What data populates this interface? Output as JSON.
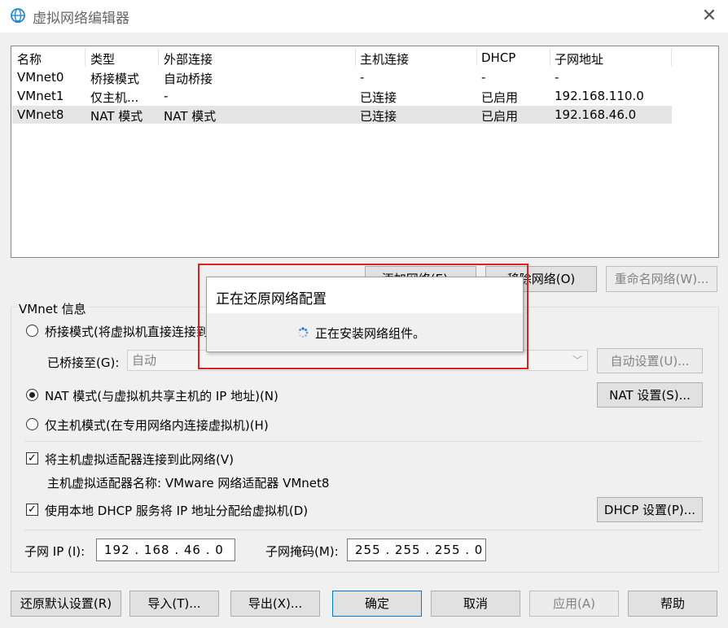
{
  "window": {
    "title": "虚拟网络编辑器",
    "close_icon": "close-icon"
  },
  "table": {
    "columns": [
      "名称",
      "类型",
      "外部连接",
      "主机连接",
      "DHCP",
      "子网地址"
    ],
    "rows": [
      [
        "VMnet0",
        "桥接模式",
        "自动桥接",
        "-",
        "-",
        "-"
      ],
      [
        "VMnet1",
        "仅主机...",
        "-",
        "已连接",
        "已启用",
        "192.168.110.0"
      ],
      [
        "VMnet8",
        "NAT 模式",
        "NAT 模式",
        "已连接",
        "已启用",
        "192.168.46.0"
      ]
    ],
    "selected_row": 2
  },
  "list_buttons": {
    "add": "添加网络(E)...",
    "remove": "移除网络(O)",
    "rename": "重命名网络(W)..."
  },
  "info": {
    "group_title": "VMnet 信息",
    "bridge_label": "桥接模式(将虚拟机直接连接到外部网络)(B)",
    "bridged_to_label": "已桥接至(G):",
    "bridged_to_value": "自动",
    "auto_settings": "自动设置(U)...",
    "nat_label": "NAT 模式(与虚拟机共享主机的 IP 地址)(N)",
    "nat_settings": "NAT 设置(S)...",
    "hostonly_label": "仅主机模式(在专用网络内连接虚拟机)(H)",
    "selected_mode": "nat",
    "connect_adapter_label": "将主机虚拟适配器连接到此网络(V)",
    "connect_adapter_checked": true,
    "adapter_name_label": "主机虚拟适配器名称: VMware 网络适配器 VMnet8",
    "dhcp_label": "使用本地 DHCP 服务将 IP 地址分配给虚拟机(D)",
    "dhcp_checked": true,
    "dhcp_settings": "DHCP 设置(P)...",
    "subnet_ip_label": "子网 IP (I):",
    "subnet_ip": "192 . 168 . 46  .  0",
    "subnet_mask_label": "子网掩码(M):",
    "subnet_mask": "255 . 255 . 255 .  0"
  },
  "bottom_buttons": {
    "restore": "还原默认设置(R)",
    "import": "导入(T)...",
    "export": "导出(X)...",
    "ok": "确定",
    "cancel": "取消",
    "apply": "应用(A)",
    "help": "帮助"
  },
  "popup": {
    "title": "正在还原网络配置",
    "message": "正在安装网络组件。",
    "spinner_icon": "loading-spinner-icon"
  },
  "colors": {
    "highlight_box": "#e31e1e",
    "selected_row": "#e5e5e5"
  }
}
